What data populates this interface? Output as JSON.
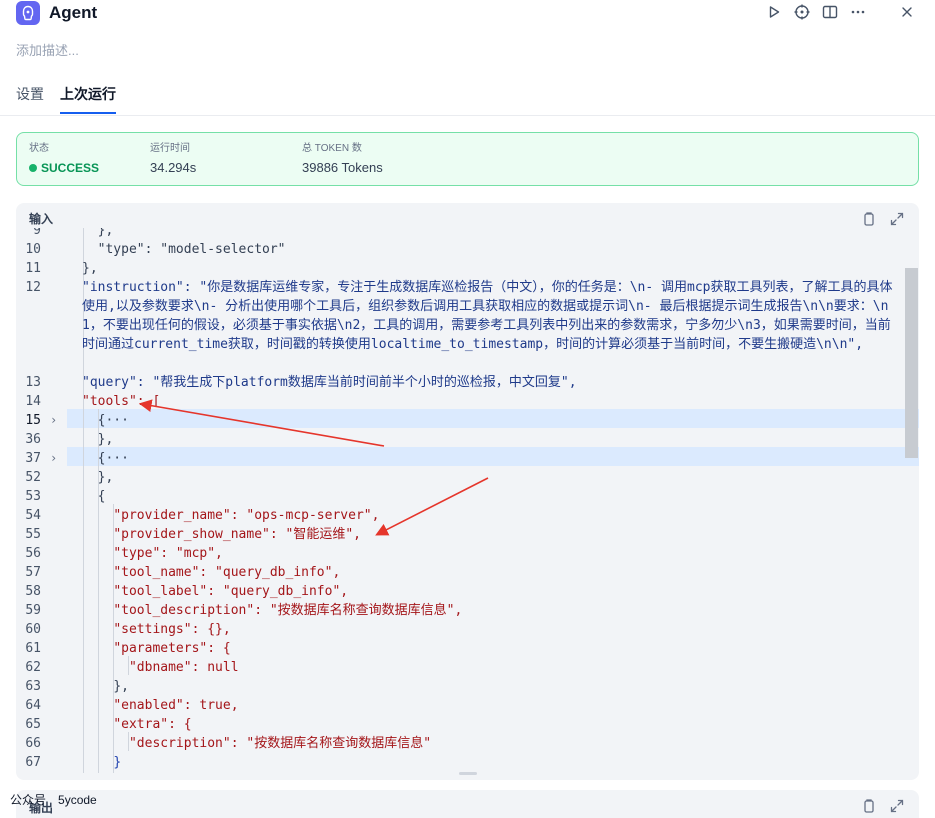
{
  "app": {
    "title": "Agent",
    "description_placeholder": "添加描述..."
  },
  "header_icons": [
    "play-icon",
    "crosshair-icon",
    "book-icon",
    "more-icon",
    "close-icon"
  ],
  "tabs": [
    {
      "label": "设置",
      "active": false
    },
    {
      "label": "上次运行",
      "active": true
    }
  ],
  "status": {
    "status_label": "状态",
    "status_value": "SUCCESS",
    "runtime_label": "运行时间",
    "runtime_value": "34.294s",
    "tokens_label": "总 TOKEN 数",
    "tokens_value": "39886 Tokens",
    "color": "#17b26a"
  },
  "input_panel": {
    "title": "输入"
  },
  "output_panel": {
    "title": "输出"
  },
  "code_lines": [
    {
      "n": "9",
      "text": "  },",
      "partial": true
    },
    {
      "n": "10",
      "text": "  \"type\": \"model-selector\""
    },
    {
      "n": "11",
      "text": "},"
    },
    {
      "n": "12",
      "text": "\"instruction\": \"你是数据库运维专家，专注于生成数据库巡检报告（中文），你的任务是：\\n- 调用mcp获取工具列表，了解工具的具体使用,以及参数要求\\n- 分析出使用哪个工具后，组织参数后调用工具获取相应的数据或提示词\\n- 最后根据提示词生成报告\\n\\n要求：\\n1，不要出现任何的假设，必须基于事实依据\\n2，工具的调用，需要参考工具列表中列出来的参数需求，宁多勿少\\n3，如果需要时间，当前时间通过current_time获取，时间戳的转换使用localtime_to_timestamp，时间的计算必须基于当前时间，不要生搬硬造\\n\\n\","
    },
    {
      "n": "13",
      "text": "\"query\": \"帮我生成下platform数据库当前时间前半个小时的巡检报，中文回复\","
    },
    {
      "n": "14",
      "text": "\"tools\": ["
    },
    {
      "n": "15",
      "text": "  {···"
    },
    {
      "n": "36",
      "text": "  },"
    },
    {
      "n": "37",
      "text": "  {···"
    },
    {
      "n": "52",
      "text": "  },"
    },
    {
      "n": "53",
      "text": "  {"
    },
    {
      "n": "54",
      "text": "    \"provider_name\": \"ops-mcp-server\","
    },
    {
      "n": "55",
      "text": "    \"provider_show_name\": \"智能运维\","
    },
    {
      "n": "56",
      "text": "    \"type\": \"mcp\","
    },
    {
      "n": "57",
      "text": "    \"tool_name\": \"query_db_info\","
    },
    {
      "n": "58",
      "text": "    \"tool_label\": \"query_db_info\","
    },
    {
      "n": "59",
      "text": "    \"tool_description\": \"按数据库名称查询数据库信息\","
    },
    {
      "n": "60",
      "text": "    \"settings\": {},"
    },
    {
      "n": "61",
      "text": "    \"parameters\": {"
    },
    {
      "n": "62",
      "text": "      \"dbname\": null"
    },
    {
      "n": "63",
      "text": "    },"
    },
    {
      "n": "64",
      "text": "    \"enabled\": true,"
    },
    {
      "n": "65",
      "text": "    \"extra\": {"
    },
    {
      "n": "66",
      "text": "      \"description\": \"按数据库名称查询数据库信息\""
    },
    {
      "n": "67",
      "text": "    }"
    }
  ],
  "watermark": {
    "label": "公众号",
    "value": "5ycode"
  }
}
